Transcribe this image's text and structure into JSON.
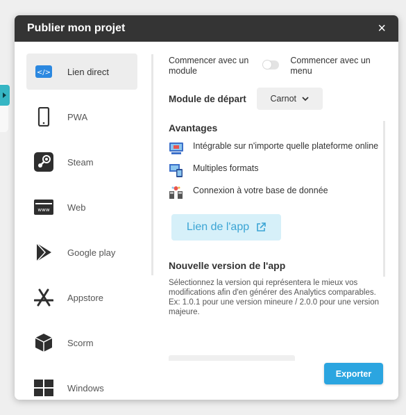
{
  "modal": {
    "title": "Publier mon projet",
    "close_label": "×"
  },
  "sidebar": {
    "items": [
      {
        "label": "Lien direct",
        "active": true
      },
      {
        "label": "PWA"
      },
      {
        "label": "Steam"
      },
      {
        "label": "Web"
      },
      {
        "label": "Google play"
      },
      {
        "label": "Appstore"
      },
      {
        "label": "Scorm"
      },
      {
        "label": "Windows"
      }
    ]
  },
  "toggle": {
    "left_label": "Commencer avec un module",
    "right_label": "Commencer avec un menu",
    "state": "off"
  },
  "module": {
    "label": "Module de départ",
    "selected": "Carnot"
  },
  "advantages": {
    "title": "Avantages",
    "items": [
      {
        "text": "Intégrable sur n'importe quelle plateforme online",
        "icon": "embed-icon"
      },
      {
        "text": "Multiples formats",
        "icon": "devices-icon"
      },
      {
        "text": "Connexion à votre base de donnée",
        "icon": "database-icon"
      }
    ]
  },
  "app_link": {
    "label": "Lien de l'app"
  },
  "version": {
    "title": "Nouvelle version de l'app",
    "description": "Sélectionnez la version qui représentera le mieux vos modifications afin d'en générer des Analytics comparables. Ex: 1.0.1 pour une version mineure / 2.0.0 pour une version majeure."
  },
  "export": {
    "label": "Exporter"
  },
  "colors": {
    "accent": "#2ba5e0",
    "header": "#343434",
    "link_bg": "#d6f0f9",
    "active_icon": "#2b88e0"
  }
}
